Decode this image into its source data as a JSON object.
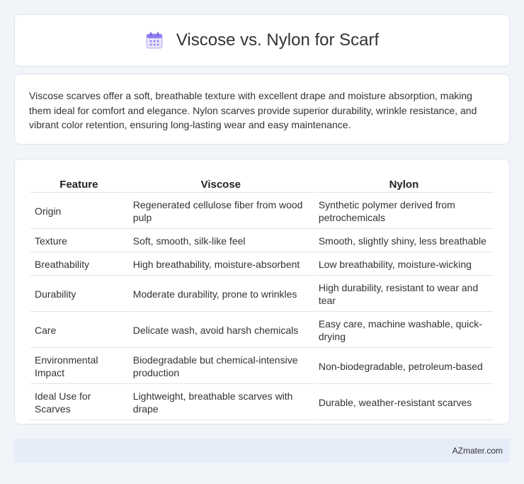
{
  "header": {
    "title": "Viscose vs. Nylon for Scarf",
    "icon": "calendar-icon"
  },
  "summary": {
    "text": "Viscose scarves offer a soft, breathable texture with excellent drape and moisture absorption, making them ideal for comfort and elegance. Nylon scarves provide superior durability, wrinkle resistance, and vibrant color retention, ensuring long-lasting wear and easy maintenance."
  },
  "table": {
    "headers": [
      "Feature",
      "Viscose",
      "Nylon"
    ],
    "rows": [
      [
        "Origin",
        "Regenerated cellulose fiber from wood pulp",
        "Synthetic polymer derived from petrochemicals"
      ],
      [
        "Texture",
        "Soft, smooth, silk-like feel",
        "Smooth, slightly shiny, less breathable"
      ],
      [
        "Breathability",
        "High breathability, moisture-absorbent",
        "Low breathability, moisture-wicking"
      ],
      [
        "Durability",
        "Moderate durability, prone to wrinkles",
        "High durability, resistant to wear and tear"
      ],
      [
        "Care",
        "Delicate wash, avoid harsh chemicals",
        "Easy care, machine washable, quick-drying"
      ],
      [
        "Environmental Impact",
        "Biodegradable but chemical-intensive production",
        "Non-biodegradable, petroleum-based"
      ],
      [
        "Ideal Use for Scarves",
        "Lightweight, breathable scarves with drape",
        "Durable, weather-resistant scarves"
      ]
    ]
  },
  "footer": {
    "text": "AZmater.com"
  }
}
